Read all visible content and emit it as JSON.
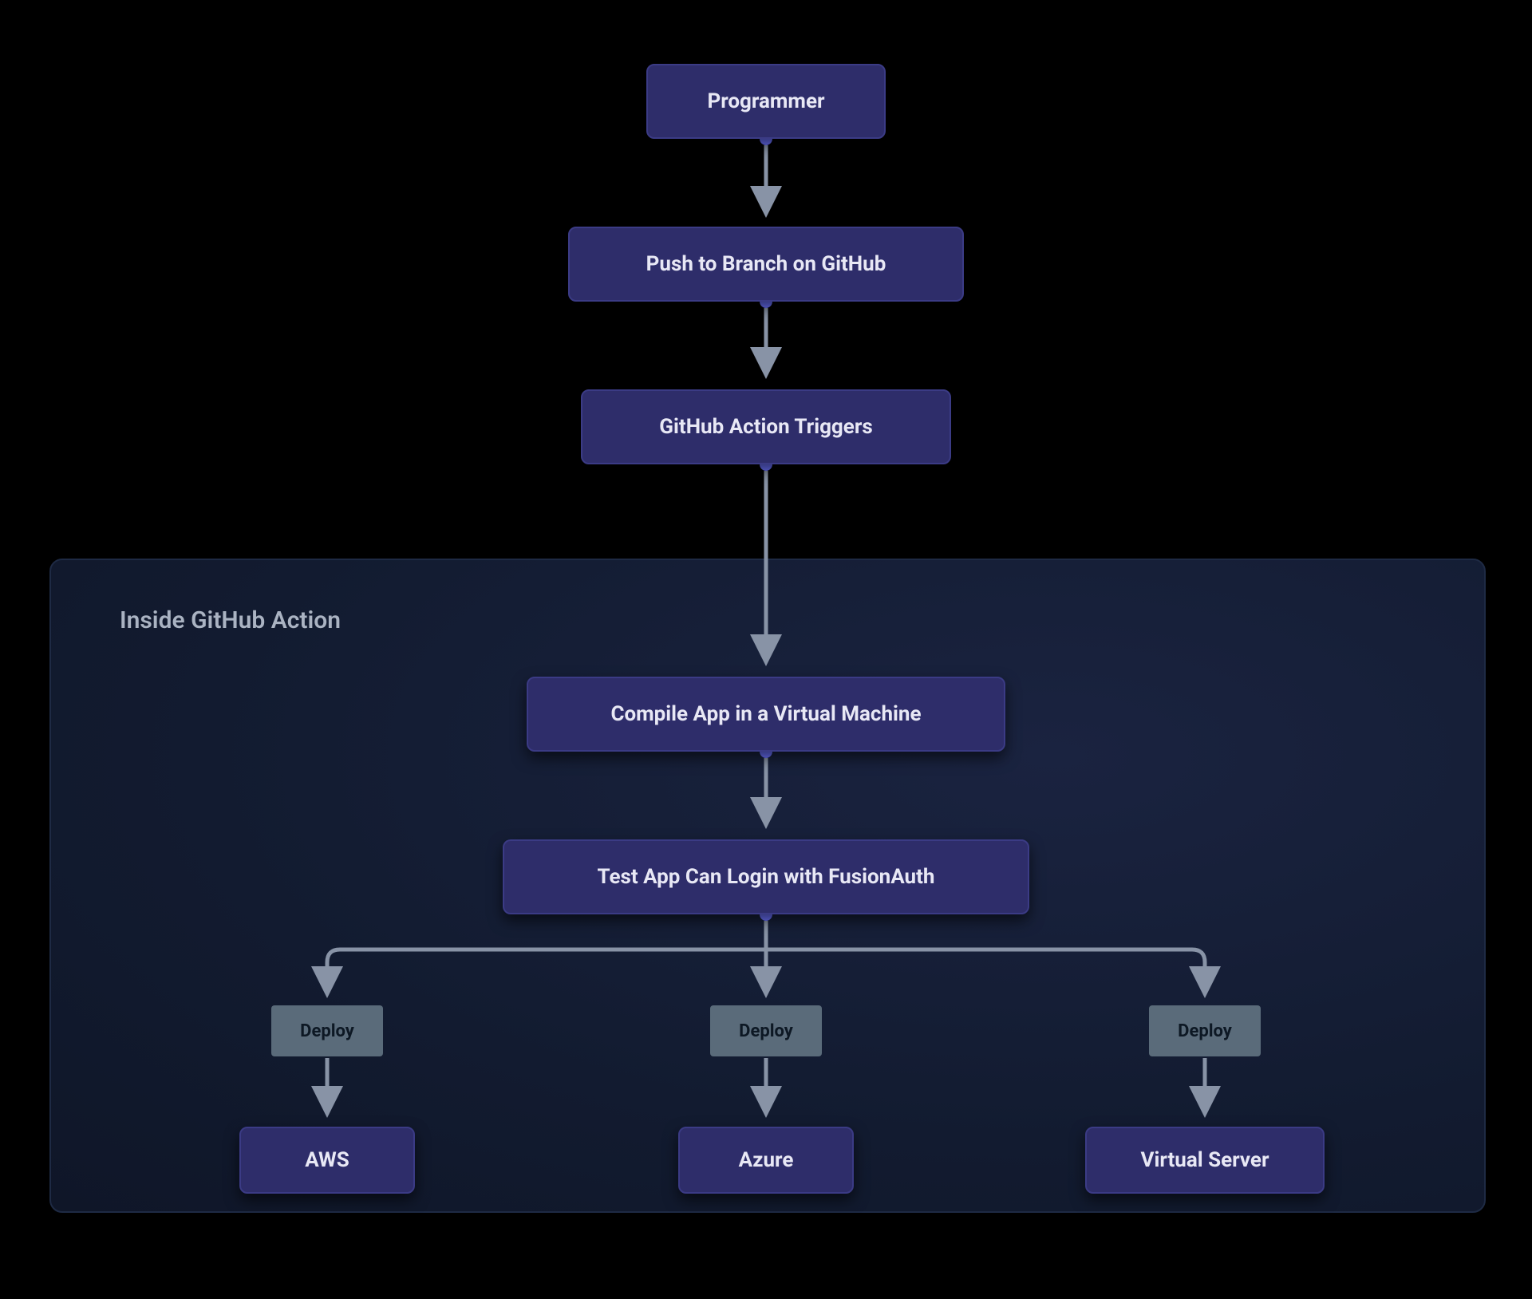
{
  "nodes": {
    "programmer": "Programmer",
    "push": "Push to Branch on GitHub",
    "triggers": "GitHub Action Triggers",
    "compile": "Compile App in a Virtual Machine",
    "test": "Test App Can Login with FusionAuth",
    "aws": "AWS",
    "azure": "Azure",
    "virtual_server": "Virtual Server"
  },
  "edge_labels": {
    "deploy1": "Deploy",
    "deploy2": "Deploy",
    "deploy3": "Deploy"
  },
  "container": {
    "title": "Inside GitHub Action"
  }
}
